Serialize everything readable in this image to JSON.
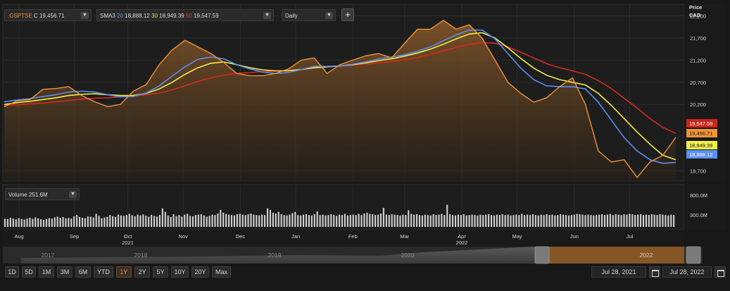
{
  "colors": {
    "price": "#f0933a",
    "sma20": "#5b8ff0",
    "sma30": "#e6e44a",
    "sma50": "#d42b20",
    "panel": "#181818",
    "grid": "#2c2c2c"
  },
  "header": {
    "symbol": ".GSPTSE",
    "close_prefix": "C",
    "close_value": "19,456.71",
    "sma_label": "SMA3",
    "sma20_period": "20",
    "sma20_value": "18,888.12",
    "sma30_period": "30",
    "sma30_value": "18,949.39",
    "sma50_period": "50",
    "sma50_value": "19,547.59",
    "interval": "Daily",
    "add_label": "+",
    "dropdown_icon": "chevron-down-icon"
  },
  "volume_header": {
    "label": "Volume",
    "value": "251.6M"
  },
  "price_axis": {
    "title_line1": "Price",
    "title_line2": "CAD",
    "ticks": [
      "22,200",
      "21,700",
      "21,200",
      "20,700",
      "20,200",
      "18,700"
    ]
  },
  "last_value_badges": [
    {
      "label": "19,547.59",
      "color": "#c9261c",
      "text_color": "#ffffff"
    },
    {
      "label": "19,456.71",
      "color": "#f0933a",
      "text_color": "#1a1a1a"
    },
    {
      "label": "18,949.39",
      "color": "#efee4c",
      "text_color": "#1a1a1a"
    },
    {
      "label": "18,888.12",
      "color": "#5b8ff0",
      "text_color": "#ffffff"
    }
  ],
  "volume_axis": {
    "ticks": [
      "800.0M",
      "300.0M"
    ]
  },
  "navigator_years": [
    "2017",
    "2018",
    "2019",
    "2020",
    "2022"
  ],
  "range_buttons": [
    {
      "label": "1D",
      "active": false
    },
    {
      "label": "5D",
      "active": false
    },
    {
      "label": "1M",
      "active": false
    },
    {
      "label": "3M",
      "active": false
    },
    {
      "label": "6M",
      "active": false
    },
    {
      "label": "YTD",
      "active": false
    },
    {
      "label": "1Y",
      "active": true
    },
    {
      "label": "2Y",
      "active": false
    },
    {
      "label": "5Y",
      "active": false
    },
    {
      "label": "10Y",
      "active": false
    },
    {
      "label": "20Y",
      "active": false
    },
    {
      "label": "Max",
      "active": false
    }
  ],
  "date_range": {
    "from": "Jul 28, 2021",
    "to": "Jul 28, 2022",
    "calendar_icon": "calendar-icon"
  },
  "chart_data": {
    "type": "line",
    "price_axis_label": "Price",
    "currency": "CAD",
    "grid": true,
    "x": [
      "2021-07-28",
      "2021-08-04",
      "2021-08-11",
      "2021-08-18",
      "2021-08-25",
      "2021-09-01",
      "2021-09-08",
      "2021-09-15",
      "2021-09-22",
      "2021-09-29",
      "2021-10-06",
      "2021-10-13",
      "2021-10-20",
      "2021-10-27",
      "2021-11-03",
      "2021-11-10",
      "2021-11-17",
      "2021-11-24",
      "2021-12-01",
      "2021-12-08",
      "2021-12-15",
      "2021-12-22",
      "2021-12-29",
      "2022-01-05",
      "2022-01-12",
      "2022-01-19",
      "2022-01-26",
      "2022-02-02",
      "2022-02-09",
      "2022-02-16",
      "2022-02-23",
      "2022-03-02",
      "2022-03-09",
      "2022-03-16",
      "2022-03-23",
      "2022-03-30",
      "2022-04-06",
      "2022-04-13",
      "2022-04-20",
      "2022-04-27",
      "2022-05-04",
      "2022-05-11",
      "2022-05-18",
      "2022-05-25",
      "2022-06-01",
      "2022-06-08",
      "2022-06-15",
      "2022-06-22",
      "2022-06-29",
      "2022-07-06",
      "2022-07-13",
      "2022-07-20",
      "2022-07-27"
    ],
    "x_tick_labels": [
      {
        "label": "Aug",
        "date": "2021-08-05"
      },
      {
        "label": "Sep",
        "date": "2021-09-04"
      },
      {
        "label": "Oct",
        "date": "2021-10-03",
        "year": "2021"
      },
      {
        "label": "Nov",
        "date": "2021-11-02"
      },
      {
        "label": "Dec",
        "date": "2021-12-03"
      },
      {
        "label": "Jan",
        "date": "2022-01-02"
      },
      {
        "label": "Feb",
        "date": "2022-02-02"
      },
      {
        "label": "Mar",
        "date": "2022-03-02"
      },
      {
        "label": "Apr",
        "date": "2022-04-02",
        "year": "2022"
      },
      {
        "label": "May",
        "date": "2022-05-02"
      },
      {
        "label": "Jun",
        "date": "2022-06-02"
      },
      {
        "label": "Jul",
        "date": "2022-07-02"
      }
    ],
    "ylim": [
      18500,
      22400
    ],
    "y_ticks": [
      22200,
      21700,
      21200,
      20700,
      20200,
      18700
    ],
    "series": [
      {
        "name": ".GSPTSE",
        "color": "#f0933a",
        "fill": true,
        "values": [
          20150,
          20280,
          20310,
          20540,
          20560,
          20600,
          20400,
          20260,
          20150,
          20200,
          20500,
          20650,
          21100,
          21430,
          21650,
          21500,
          21350,
          21150,
          20900,
          20850,
          20850,
          20900,
          21000,
          21200,
          21250,
          20900,
          21100,
          21200,
          21300,
          21350,
          21250,
          21580,
          21900,
          21900,
          22100,
          21900,
          22000,
          21700,
          21200,
          20700,
          20450,
          20250,
          20350,
          20600,
          20800,
          20200,
          19150,
          18900,
          18950,
          18550,
          18900,
          19050,
          19456.71
        ]
      },
      {
        "name": "SMA 20",
        "color": "#5b8ff0",
        "values": [
          20260,
          20300,
          20330,
          20380,
          20420,
          20480,
          20500,
          20480,
          20420,
          20370,
          20380,
          20460,
          20620,
          20840,
          21050,
          21220,
          21270,
          21230,
          21100,
          21000,
          20930,
          20900,
          20920,
          20990,
          21060,
          21060,
          21070,
          21110,
          21160,
          21230,
          21270,
          21320,
          21400,
          21500,
          21640,
          21770,
          21880,
          21880,
          21680,
          21350,
          21020,
          20760,
          20620,
          20600,
          20600,
          20550,
          20250,
          19850,
          19450,
          19150,
          18950,
          18870,
          18888.12
        ]
      },
      {
        "name": "SMA 30",
        "color": "#efee4c",
        "values": [
          20200,
          20240,
          20270,
          20310,
          20350,
          20400,
          20430,
          20440,
          20420,
          20400,
          20400,
          20450,
          20550,
          20700,
          20880,
          21030,
          21130,
          21160,
          21100,
          21030,
          20980,
          20960,
          20960,
          20990,
          21030,
          21050,
          21070,
          21100,
          21140,
          21190,
          21230,
          21290,
          21360,
          21450,
          21560,
          21680,
          21790,
          21820,
          21700,
          21480,
          21240,
          21020,
          20860,
          20760,
          20700,
          20640,
          20450,
          20180,
          19880,
          19580,
          19300,
          19050,
          18949.39
        ]
      },
      {
        "name": "SMA 50",
        "color": "#d42b20",
        "values": [
          20180,
          20190,
          20210,
          20230,
          20260,
          20290,
          20320,
          20340,
          20350,
          20370,
          20390,
          20420,
          20460,
          20530,
          20620,
          20720,
          20800,
          20860,
          20900,
          20920,
          20940,
          20950,
          20970,
          20990,
          21020,
          21050,
          21070,
          21090,
          21110,
          21140,
          21170,
          21210,
          21260,
          21330,
          21410,
          21490,
          21560,
          21600,
          21580,
          21500,
          21380,
          21250,
          21120,
          21030,
          20960,
          20880,
          20740,
          20560,
          20340,
          20120,
          19880,
          19680,
          19547.59
        ]
      }
    ],
    "volume": {
      "label": "Volume",
      "unit": "M",
      "y_ticks": [
        800,
        300
      ],
      "ylim": [
        0,
        1000
      ],
      "values": [
        205,
        200,
        230,
        210,
        190,
        220,
        200,
        185,
        210,
        230,
        205,
        240,
        215,
        195,
        180,
        200,
        220,
        210,
        240,
        260,
        230,
        250,
        215,
        225,
        210,
        270,
        300,
        250,
        230,
        220,
        265,
        260,
        240,
        330,
        280,
        220,
        240,
        255,
        300,
        270,
        250,
        310,
        290,
        280,
        300,
        330,
        295,
        270,
        310,
        290,
        315,
        285,
        260,
        305,
        275,
        260,
        300,
        470,
        380,
        290,
        250,
        320,
        270,
        300,
        260,
        310,
        330,
        280,
        270,
        300,
        310,
        320,
        290,
        260,
        280,
        310,
        300,
        340,
        430,
        360,
        330,
        310,
        300,
        290,
        320,
        330,
        310,
        300,
        320,
        340,
        310,
        300,
        290,
        310,
        300,
        470,
        430,
        360,
        340,
        380,
        320,
        300,
        290,
        310,
        350,
        380,
        300,
        290,
        310,
        320,
        300,
        290,
        320,
        390,
        300,
        310,
        290,
        300,
        320,
        300,
        280,
        310,
        300,
        330,
        290,
        300,
        310,
        300,
        330,
        300,
        340,
        360,
        330,
        320,
        300,
        310,
        340,
        480,
        310,
        300,
        320,
        310,
        300,
        290,
        310,
        300,
        420,
        330,
        310,
        320,
        300,
        290,
        310,
        300,
        290,
        320,
        300,
        310,
        330,
        300,
        560,
        320,
        300,
        290,
        310,
        300,
        320,
        290,
        300,
        310,
        300,
        290,
        310,
        300,
        310,
        320,
        300,
        290,
        310,
        300,
        320,
        300,
        310,
        290,
        300,
        310,
        300,
        330,
        300,
        310,
        300,
        320,
        300,
        290,
        310,
        300,
        320,
        300,
        310,
        290,
        300,
        320,
        310,
        300,
        290,
        300,
        310,
        330,
        320,
        310,
        300,
        310,
        300,
        290,
        300,
        310,
        320,
        300,
        310,
        330,
        300,
        320,
        310,
        300,
        320,
        310,
        330,
        320,
        300,
        310,
        320,
        300,
        310,
        300,
        320,
        310,
        300,
        320,
        310,
        300,
        290,
        310,
        300
      ]
    },
    "navigator": {
      "years": [
        "2017",
        "2018",
        "2019",
        "2020",
        "2022"
      ],
      "selected_from": "Jul 28, 2021",
      "selected_to": "Jul 28, 2022"
    }
  }
}
